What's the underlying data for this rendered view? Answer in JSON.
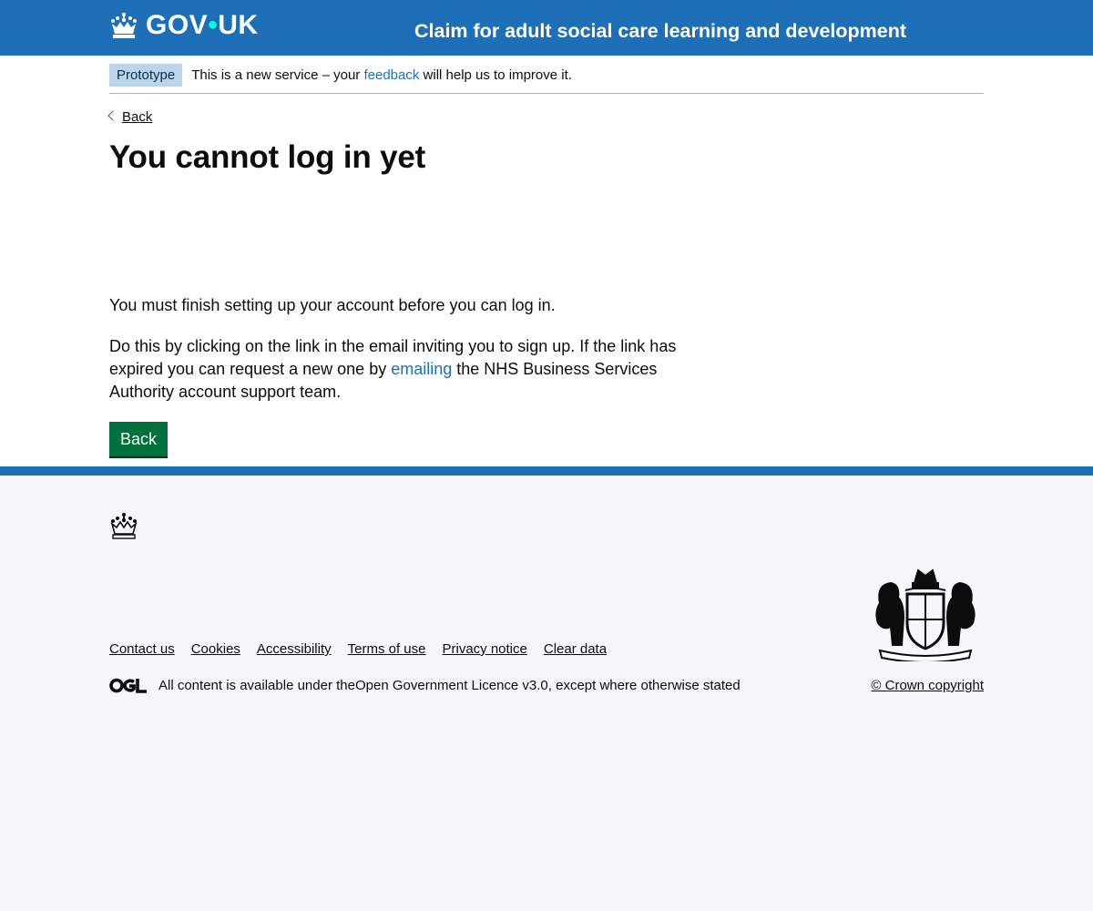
{
  "header": {
    "logo_text_left": "GOV",
    "logo_dot": "•",
    "logo_text_right": "UK",
    "service_name": "Claim for adult social care learning and development"
  },
  "phase_banner": {
    "tag": "Prototype",
    "text_before": "This is a new service – your ",
    "link": "feedback",
    "text_after": " will help us to improve it."
  },
  "back_link": "Back",
  "main": {
    "heading": "You cannot log in yet",
    "paragraph_1": "You must finish setting up your account before you can log in.",
    "paragraph_2_before": "Do this by clicking on the link in the email inviting you to sign up. If the link has expired you can request a new one by ",
    "paragraph_2_link": "emailing",
    "paragraph_2_after": " the NHS Business Services Authority account support team.",
    "button": "Back"
  },
  "footer": {
    "links": [
      {
        "label": "Contact us"
      },
      {
        "label": "Cookies"
      },
      {
        "label": "Accessibility"
      },
      {
        "label": "Terms of use"
      },
      {
        "label": "Privacy notice"
      },
      {
        "label": "Clear data"
      }
    ],
    "licence_before": "All content is available under the ",
    "licence_link": "Open Government Licence v3.0",
    "licence_after": ", except where otherwise stated",
    "copyright": "© Crown copyright"
  },
  "colors": {
    "header_blue": "#1d70b8",
    "button_green": "#00703c",
    "tag_blue": "#bbd4ea",
    "footer_bg": "#f4f8fb"
  }
}
